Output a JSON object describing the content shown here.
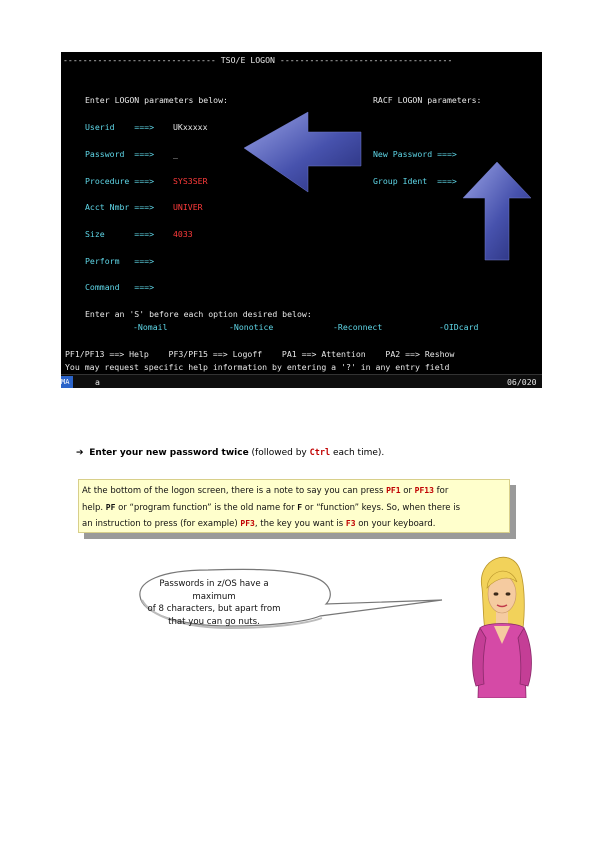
{
  "terminal": {
    "header": "------------------------------- TSO/E LOGON -----------------------------------",
    "enter_params": "Enter LOGON parameters below:",
    "racf_params": "RACF LOGON parameters:",
    "userid_label": "Userid    ===>",
    "userid_value": "UKxxxxx",
    "password_label": "Password  ===>",
    "password_value": "_",
    "new_password_label": "New Password ===>",
    "procedure_label": "Procedure ===>",
    "procedure_value": "SYS3SER",
    "group_ident_label": "Group Ident  ===>",
    "acct_label": "Acct Nmbr ===>",
    "acct_value": "UNIVER",
    "size_label": "Size      ===>",
    "size_value": "4033",
    "perform_label": "Perform   ===>",
    "command_label": "Command   ===>",
    "enter_option": "Enter an 'S' before each option desired below:",
    "options": [
      "-Nomail",
      "-Nonotice",
      "-Reconnect",
      "-OIDcard"
    ],
    "pf_line": "PF1/PF13 ==> Help    PF3/PF15 ==> Logoff    PA1 ==> Attention    PA2 ==> Reshow",
    "help_line": "You may request specific help information by entering a '?' in any entry field",
    "status_left": "MA",
    "status_mid": "a",
    "status_right": "06/020"
  },
  "bullet": {
    "arrow": "➔",
    "bold_text": "Enter your new password twice",
    "text_before": " (followed by ",
    "key": "Ctrl",
    "text_after": " each time)."
  },
  "note": {
    "l1a": "At the bottom of the logon screen, there is a note to say you can press ",
    "pf1": "PF1",
    "l1b": " or ",
    "pf13": "PF13",
    "l1c": " for",
    "l2a": "help.  ",
    "pf": "PF",
    "l2b": " or “program function” is the old name for ",
    "f": "F",
    "l2c": " or “function” keys.  So, when there is",
    "l3a": "an instruction to press (for example) ",
    "pf3": "PF3",
    "l3b": ", the key you want is ",
    "f3": "F3",
    "l3c": " on your keyboard."
  },
  "bubble": {
    "line1": "Passwords in z/OS have a maximum",
    "line2": "of 8 characters, but apart from",
    "line3": "that you can go nuts."
  },
  "colors": {
    "terminal_bg": "#000000",
    "field_label": "#5fd7e8",
    "field_value": "#ff3b3b",
    "arrow_fill": "#4a55b0",
    "note_bg": "#ffffcc",
    "key_red": "#c00000"
  }
}
